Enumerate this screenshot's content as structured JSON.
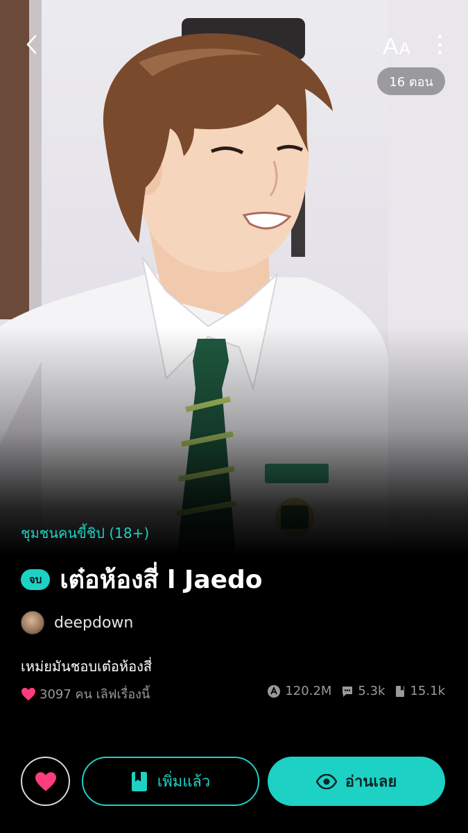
{
  "top_bar": {
    "font_size_label_big": "A",
    "font_size_label_small": "A",
    "episodes": "16 ตอน"
  },
  "story": {
    "category": "ชุมชนคนขี้ชิป (18+)",
    "status": "จบ",
    "title": "เต๋อห้องสี่ l Jaedo",
    "author": "deepdown",
    "description": "เหม่ยมันชอบเต๋อห้องสี่",
    "likes_text": "3097 คน เลิฟเรื่องนี้",
    "views": "120.2M",
    "comments": "5.3k",
    "bookmarks": "15.1k"
  },
  "actions": {
    "added_label": "เพิ่มแล้ว",
    "read_label": "อ่านเลย"
  },
  "colors": {
    "accent": "#1dd1c5",
    "heart": "#ff3d7a",
    "muted": "#9a9a9a",
    "background": "#000000"
  },
  "icons": {
    "back": "chevron-left-icon",
    "more": "more-vertical-icon",
    "heart": "heart-icon",
    "views": "views-icon",
    "comments": "comment-icon",
    "bookmarks": "book-icon",
    "added": "bookmark-icon",
    "read": "eye-icon"
  }
}
